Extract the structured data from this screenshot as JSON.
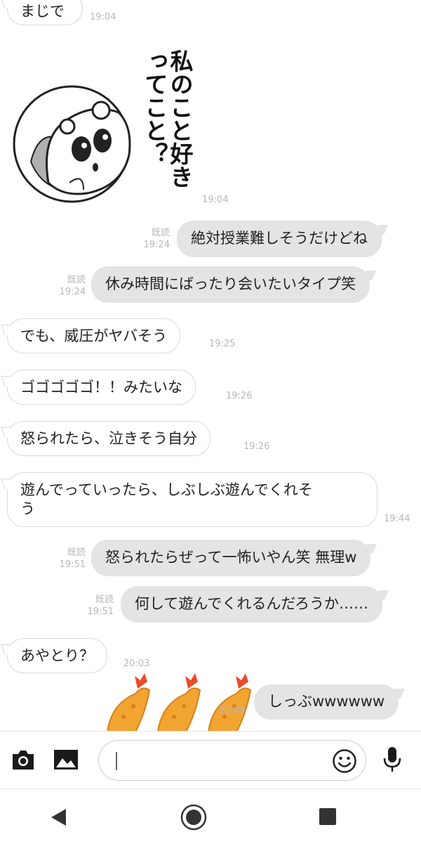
{
  "messages": {
    "m1": {
      "text": "まじで",
      "time": "19:04"
    },
    "sticker1": {
      "text": "私のこと好きってこと？",
      "time": "19:04"
    },
    "m3": {
      "text": "絶対授業難しそうだけどね",
      "read": "既読",
      "time": "19:24"
    },
    "m4": {
      "text": "休み時間にばったり会いたいタイプ笑",
      "read": "既読",
      "time": "19:24"
    },
    "m5": {
      "text": "でも、威圧がヤバそう",
      "time": "19:25"
    },
    "m6": {
      "text": "ゴゴゴゴゴ！！みたいな",
      "time": "19:26"
    },
    "m7": {
      "text": "怒られたら、泣きそう自分",
      "time": "19:26"
    },
    "m8": {
      "line1": "遊んでっていったら、しぶしぶ遊んでくれそ",
      "line2": "う",
      "time": "19:44"
    },
    "m9": {
      "text": "怒られたらぜって一怖いやん笑 無理w",
      "read": "既読",
      "time": "19:51"
    },
    "m10": {
      "text": "何して遊んでくれるんだろうか……",
      "read": "既読",
      "time": "19:51"
    },
    "m11": {
      "text": "あやとり？",
      "time": "20:03"
    },
    "m12": {
      "text": "しっぶwwwwww",
      "time": "20:09"
    }
  },
  "icons": {
    "camera": "camera-icon",
    "image": "image-icon",
    "emoji": "emoji-icon",
    "mic": "microphone-icon",
    "back": "back-icon",
    "home": "home-icon",
    "recents": "recents-icon"
  }
}
